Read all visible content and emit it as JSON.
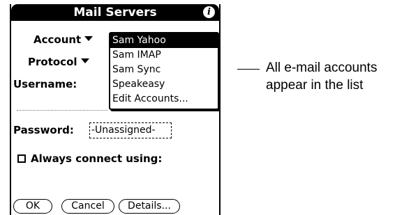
{
  "app": {
    "title": "Mail Servers",
    "info_icon": "info-icon"
  },
  "form": {
    "account_label": "Account",
    "protocol_label": "Protocol",
    "username_label": "Username:",
    "password_label": "Password:",
    "password_value": "-Unassigned-",
    "always_connect_label": "Always connect using:",
    "always_connect_checked": false
  },
  "popup": {
    "items": [
      {
        "label": "Sam Yahoo",
        "selected": true
      },
      {
        "label": "Sam IMAP",
        "selected": false
      },
      {
        "label": "Sam Sync",
        "selected": false
      },
      {
        "label": "Speakeasy",
        "selected": false
      },
      {
        "label": "Edit Accounts...",
        "selected": false
      }
    ]
  },
  "buttons": {
    "ok": "OK",
    "cancel": "Cancel",
    "details": "Details..."
  },
  "callout": {
    "line1": "All e-mail accounts",
    "line2": "appear in the list"
  }
}
